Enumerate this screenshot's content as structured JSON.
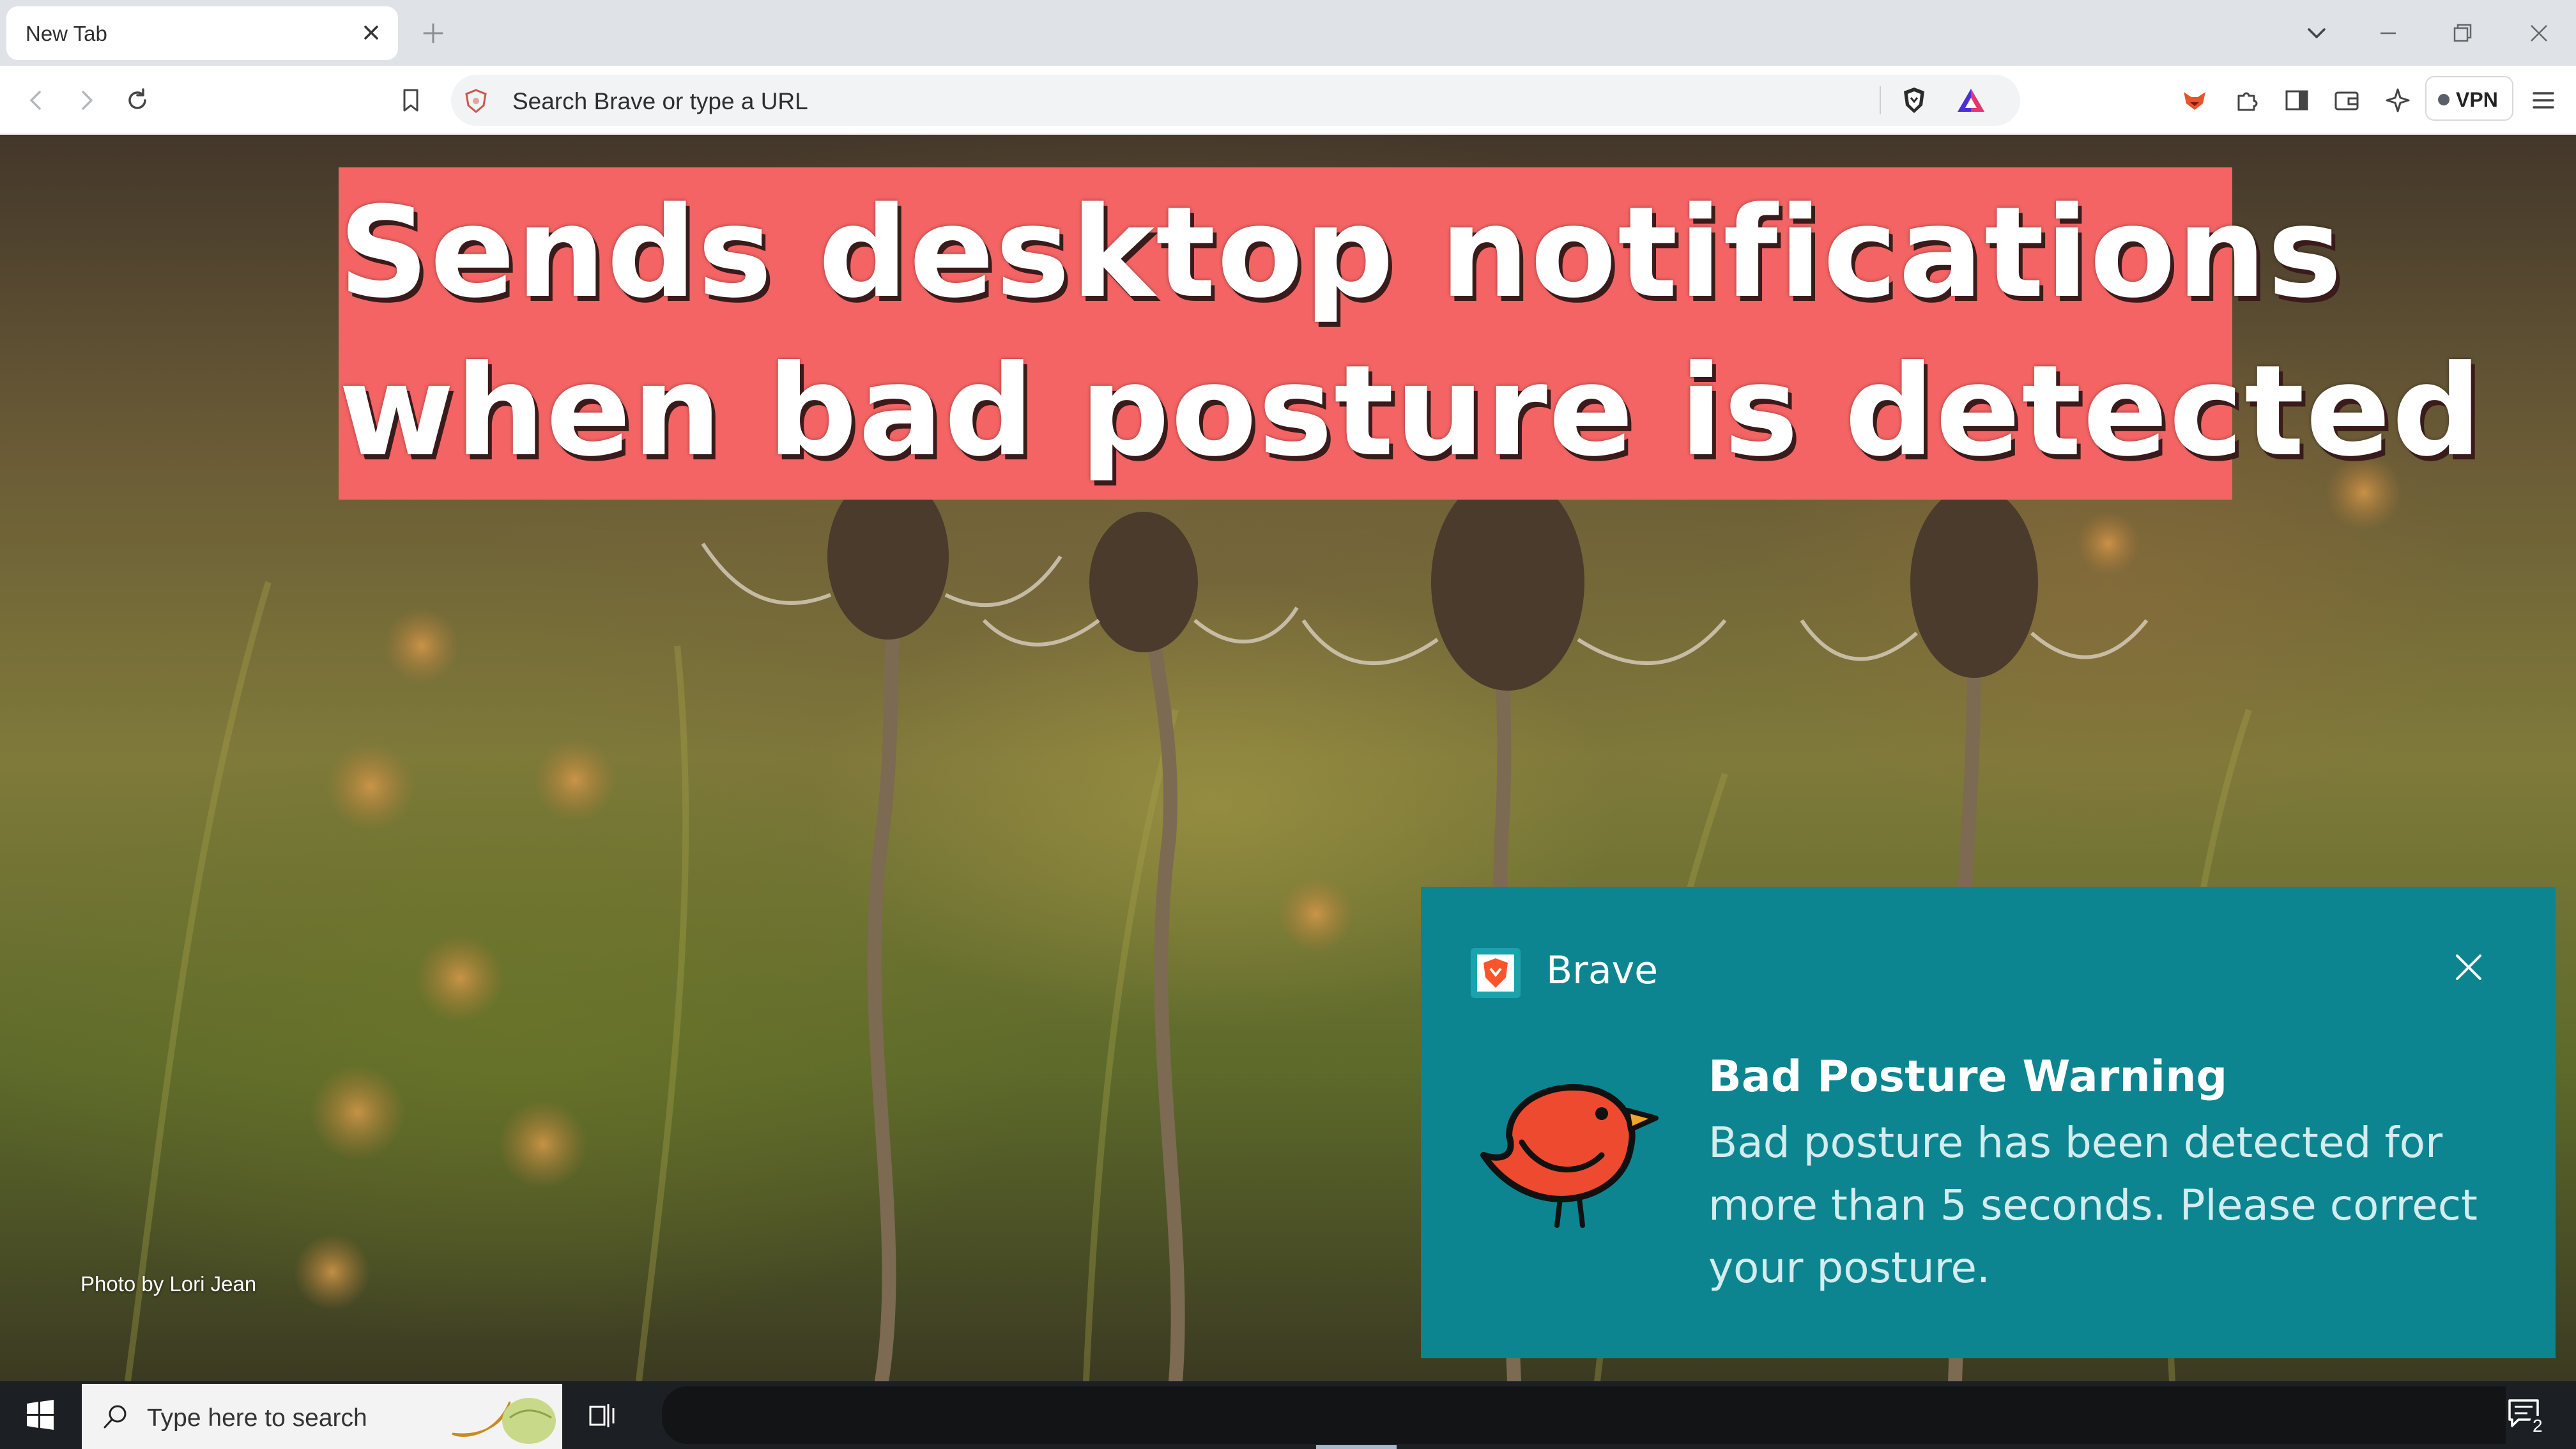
{
  "browser": {
    "tab": {
      "title": "New Tab"
    },
    "address_bar": {
      "placeholder": "Search Brave or type a URL"
    },
    "vpn_label": "VPN",
    "accent_color": "#fb542b"
  },
  "new_tab_page": {
    "photo_credit": "Photo by Lori Jean"
  },
  "banner": {
    "line1": "Sends desktop notifications",
    "line2": "when bad posture is detected",
    "background_color": "#f46464"
  },
  "notification": {
    "app_name": "Brave",
    "title": "Bad Posture Warning",
    "body": "Bad posture has been detected for more than 5 seconds. Please correct your posture.",
    "background_color": "#0c8590",
    "image_icon": "red-bird-icon"
  },
  "taskbar": {
    "search_placeholder": "Type here to search",
    "notification_count": "2"
  }
}
